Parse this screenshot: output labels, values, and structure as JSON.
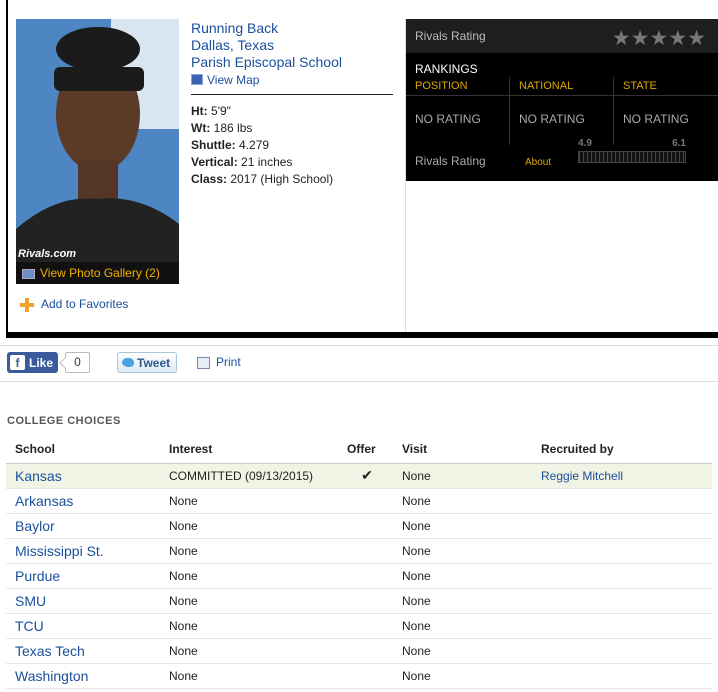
{
  "player": {
    "position": "Running Back",
    "location": "Dallas, Texas",
    "school": "Parish Episcopal School",
    "view_map": "View Map",
    "stats": [
      {
        "label": "Ht:",
        "value": "5'9\""
      },
      {
        "label": "Wt:",
        "value": "186 lbs"
      },
      {
        "label": "Shuttle:",
        "value": "4.279"
      },
      {
        "label": "Vertical:",
        "value": "21 inches"
      },
      {
        "label": "Class:",
        "value": "2017 (High School)"
      }
    ],
    "photo_watermark": "Rivals.com",
    "view_gallery": "View Photo Gallery (2)",
    "add_favorites": "Add to Favorites"
  },
  "rating": {
    "title": "Rivals Rating",
    "stars": "★★★★★",
    "rankings_label": "RANKINGS",
    "columns": [
      "POSITION",
      "NATIONAL",
      "STATE"
    ],
    "values": [
      "NO RATING",
      "NO RATING",
      "NO RATING"
    ],
    "footer_label": "Rivals Rating",
    "about": "About",
    "scale_min": "4.9",
    "scale_max": "6.1"
  },
  "social": {
    "like_label": "Like",
    "like_count": "0",
    "tweet_label": "Tweet",
    "print_label": "Print"
  },
  "college_choices": {
    "title": "COLLEGE CHOICES",
    "headers": {
      "school": "School",
      "interest": "Interest",
      "offer": "Offer",
      "visit": "Visit",
      "recruited_by": "Recruited by"
    },
    "rows": [
      {
        "school": "Kansas",
        "interest": "COMMITTED (09/13/2015)",
        "offer": "✔",
        "visit": "None",
        "recruited_by": "Reggie Mitchell"
      },
      {
        "school": "Arkansas",
        "interest": "None",
        "offer": "",
        "visit": "None",
        "recruited_by": ""
      },
      {
        "school": "Baylor",
        "interest": "None",
        "offer": "",
        "visit": "None",
        "recruited_by": ""
      },
      {
        "school": "Mississippi St.",
        "interest": "None",
        "offer": "",
        "visit": "None",
        "recruited_by": ""
      },
      {
        "school": "Purdue",
        "interest": "None",
        "offer": "",
        "visit": "None",
        "recruited_by": ""
      },
      {
        "school": "SMU",
        "interest": "None",
        "offer": "",
        "visit": "None",
        "recruited_by": ""
      },
      {
        "school": "TCU",
        "interest": "None",
        "offer": "",
        "visit": "None",
        "recruited_by": ""
      },
      {
        "school": "Texas Tech",
        "interest": "None",
        "offer": "",
        "visit": "None",
        "recruited_by": ""
      },
      {
        "school": "Washington",
        "interest": "None",
        "offer": "",
        "visit": "None",
        "recruited_by": ""
      }
    ]
  }
}
